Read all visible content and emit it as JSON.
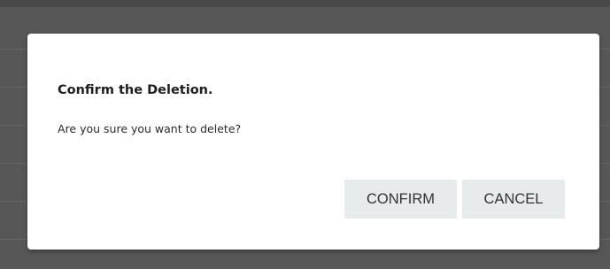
{
  "dialog": {
    "title": "Confirm the Deletion.",
    "message": "Are you sure you want to delete?",
    "confirm_label": "CONFIRM",
    "cancel_label": "CANCEL"
  },
  "colors": {
    "backdrop": "#575757",
    "dialog_background": "#ffffff",
    "button_background": "#e8ebec",
    "button_text": "#333333"
  }
}
